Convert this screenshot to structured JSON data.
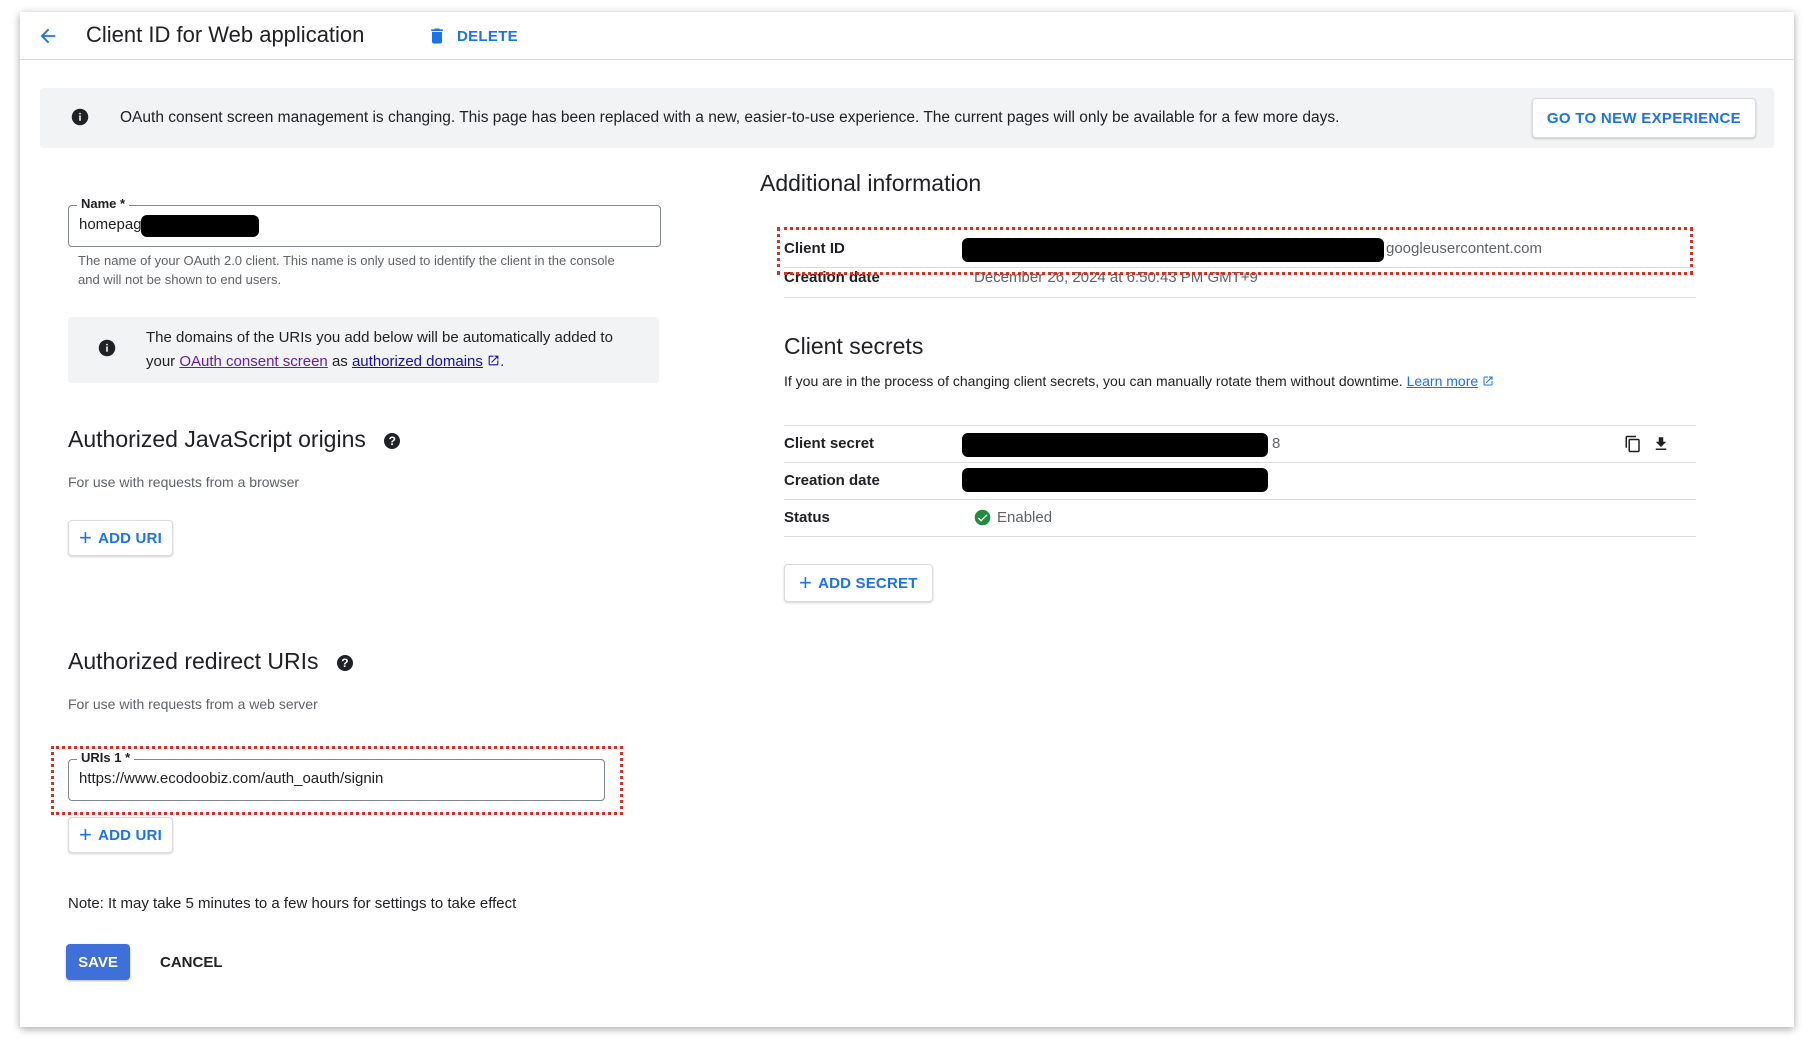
{
  "header": {
    "title": "Client ID for Web application",
    "delete_label": "DELETE",
    "colors": {
      "accent": "#1a73e8"
    }
  },
  "banner": {
    "text": "OAuth consent screen management is changing. This page has been replaced with a new, easier-to-use experience. The current pages will only be available for a few more days.",
    "button": "GO TO NEW EXPERIENCE",
    "icon": "info-icon"
  },
  "name_field": {
    "label": "Name *",
    "value": "homepag",
    "helper": "The name of your OAuth 2.0 client. This name is only used to identify the client in the console and will not be shown to end users."
  },
  "domains_info": {
    "text_before": "The domains of the URIs you add below will be automatically added to your",
    "consent_link": "OAuth consent screen",
    "text_mid": "as",
    "domains_link": "authorized domains",
    "text_end": "."
  },
  "js_origins": {
    "title": "Authorized JavaScript origins",
    "subtitle": "For use with requests from a browser",
    "add_label": "ADD URI"
  },
  "redirect_uris": {
    "title": "Authorized redirect URIs",
    "subtitle": "For use with requests from a web server",
    "uri_label": "URIs 1 *",
    "uri_value": "https://www.ecodoobiz.com/auth_oauth/signin",
    "add_label": "ADD URI"
  },
  "note": "Note: It may take 5 minutes to a few hours for settings to take effect",
  "actions": {
    "save": "SAVE",
    "cancel": "CANCEL"
  },
  "additional_info": {
    "title": "Additional information",
    "client_id_label": "Client ID",
    "client_id_value_suffix": "googleusercontent.com",
    "creation_date_label": "Creation date",
    "creation_date_value": "December 26, 2024 at 6:50:43 PM GMT+9"
  },
  "client_secrets": {
    "title": "Client secrets",
    "description": "If you are in the process of changing client secrets, you can manually rotate them without downtime.",
    "learn_more": "Learn more",
    "rows": {
      "secret_label": "Client secret",
      "secret_suffix": "8",
      "creation_label": "Creation date",
      "status_label": "Status",
      "status_value": "Enabled"
    },
    "add_label": "ADD SECRET"
  }
}
